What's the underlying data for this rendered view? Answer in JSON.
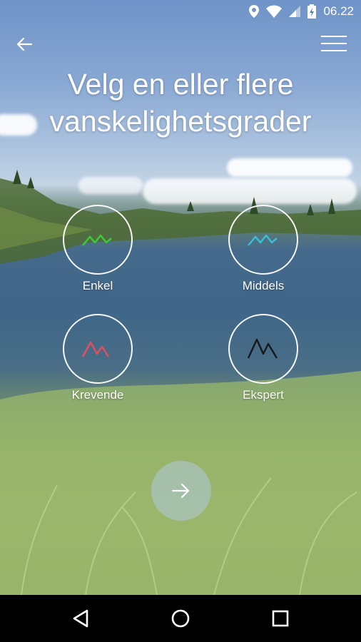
{
  "status_bar": {
    "time": "06.22",
    "icons": [
      "location-icon",
      "wifi-icon",
      "signal-icon",
      "battery-icon"
    ]
  },
  "toolbar": {
    "back_icon": "arrow-left-icon",
    "menu_icon": "hamburger-menu-icon"
  },
  "title": {
    "line1": "Velg en eller flere",
    "line2": "vanskelighetsgrader"
  },
  "difficulties": [
    {
      "label": "Enkel",
      "color": "#3fc93a"
    },
    {
      "label": "Middels",
      "color": "#39bfd6"
    },
    {
      "label": "Krevende",
      "color": "#e0505f"
    },
    {
      "label": "Ekspert",
      "color": "#1a1a1a"
    }
  ],
  "next_button": {
    "icon": "arrow-right-icon"
  },
  "nav_bar": {
    "icons": [
      "back-triangle-icon",
      "home-circle-icon",
      "recents-square-icon"
    ]
  }
}
